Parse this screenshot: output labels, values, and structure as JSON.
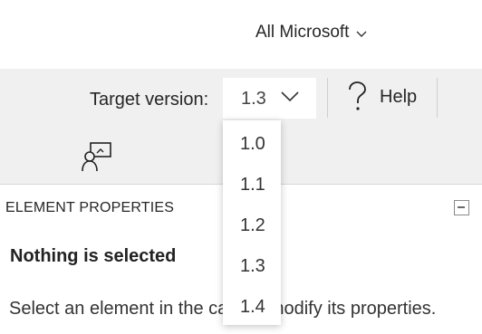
{
  "header": {
    "scope_label": "All Microsoft"
  },
  "toolbar": {
    "target_version_label": "Target version:",
    "target_version_value": "1.3",
    "help_label": "Help"
  },
  "version_options": [
    "1.0",
    "1.1",
    "1.2",
    "1.3",
    "1.4"
  ],
  "panel": {
    "title": "ELEMENT PROPERTIES",
    "empty_title": "Nothing is selected",
    "empty_message": "Select an element in the card to modify its properties."
  },
  "icons": {
    "scope_chevron": "chevron-down-icon",
    "version_chevron": "chevron-down-icon",
    "help": "question-mark-icon",
    "presenter": "presenter-icon",
    "collapse": "collapse-minus-icon"
  },
  "colors": {
    "toolbar_bg": "#f0f0f0",
    "page_bg": "#ffffff",
    "text": "#262626"
  }
}
